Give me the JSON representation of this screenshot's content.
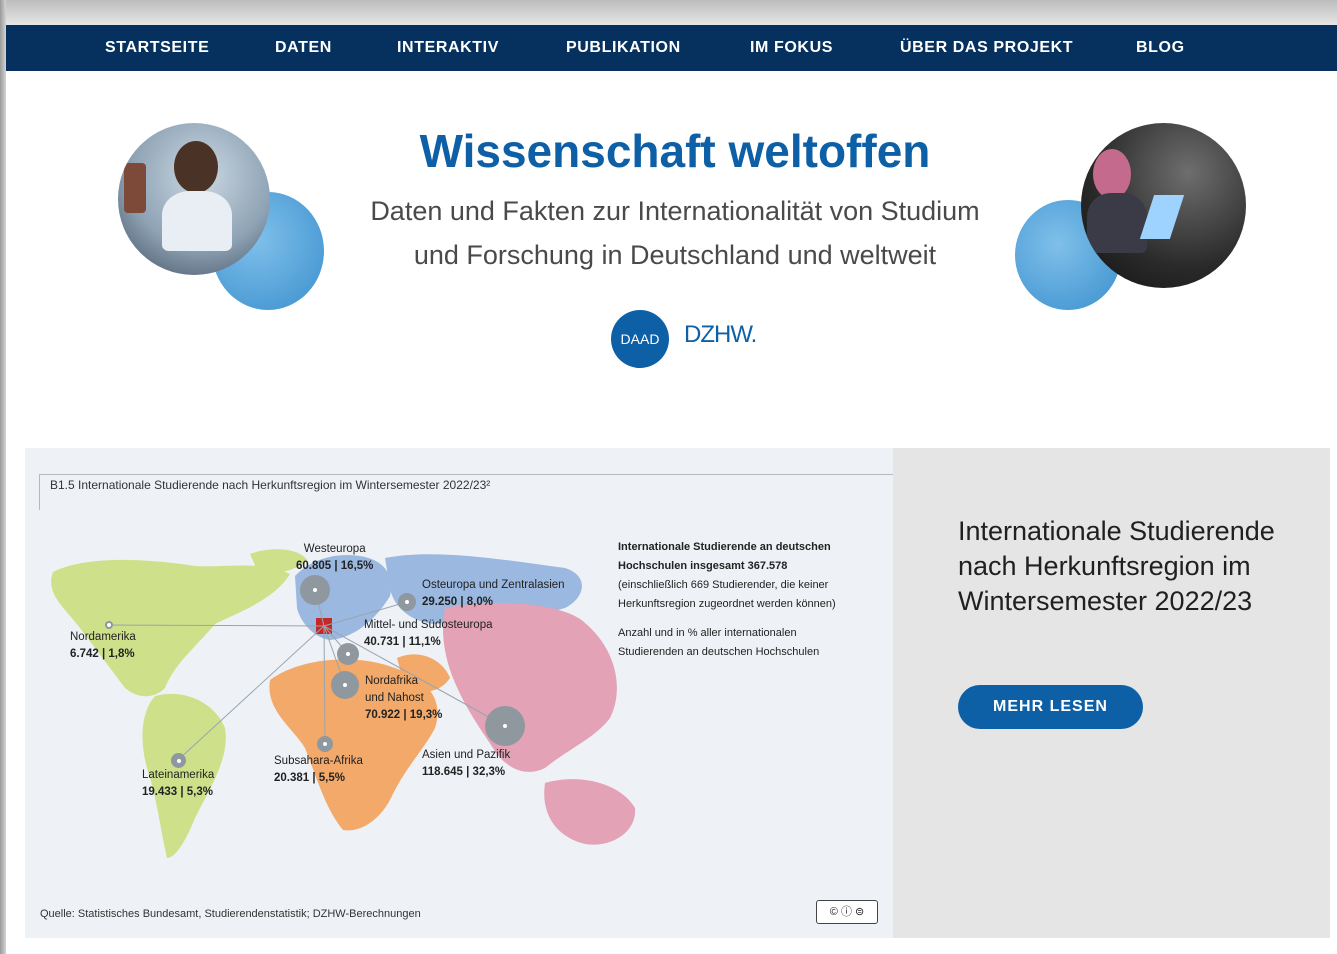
{
  "nav": {
    "items": [
      "STARTSEITE",
      "DATEN",
      "INTERAKTIV",
      "PUBLIKATION",
      "IM FOKUS",
      "ÜBER DAS PROJEKT",
      "BLOG"
    ]
  },
  "hero": {
    "title": "Wissenschaft weltoffen",
    "subtitle_line1": "Daten und Fakten zur Internationalität von Studium",
    "subtitle_line2": "und Forschung in Deutschland und weltweit",
    "logo_daad": "DAAD",
    "logo_dzhw": "DZHW."
  },
  "teaser": {
    "figure": {
      "title": "B1.5  Internationale Studierende nach Herkunftsregion im Wintersemester 2022/23²",
      "regions": [
        {
          "name": "Westeuropa",
          "value": "60.805 | 16,5%"
        },
        {
          "name": "Osteuropa und Zentralasien",
          "value": "29.250 | 8,0%"
        },
        {
          "name": "Mittel- und Südosteuropa",
          "value": "40.731 | 11,1%"
        },
        {
          "name": "Nordamerika",
          "value": "6.742 | 1,8%"
        },
        {
          "name_line1": "Nordafrika",
          "name_line2": "und Nahost",
          "value": "70.922 | 19,3%"
        },
        {
          "name": "Subsahara-Afrika",
          "value": "20.381 | 5,5%"
        },
        {
          "name": "Asien und Pazifik",
          "value": "118.645 | 32,3%"
        },
        {
          "name": "Lateinamerika",
          "value": "19.433 | 5,3%"
        }
      ],
      "info_line1": "Internationale Studierende an deutschen",
      "info_line2": "Hochschulen insgesamt 367.578",
      "info_line3": "(einschließlich 669 Studierender, die keiner",
      "info_line4": "Herkunftsregion zugeordnet werden können)",
      "info_line5": "Anzahl und in % aller internationalen",
      "info_line6": "Studierenden an deutschen Hochschulen",
      "source": "Quelle: Statistisches Bundesamt, Studierendenstatistik; DZHW-Berechnungen",
      "license": "© ⓘ ⊜"
    },
    "title": "Internationale Studierende nach Herkunftsregion im Wintersemester 2022/23",
    "button": "MEHR LESEN"
  },
  "colors": {
    "nav_bg": "#06315e",
    "brand_blue": "#0d5fa6",
    "map_europe": "#9ab8e0",
    "map_americas": "#cfe08a",
    "map_africa": "#f2a96a",
    "map_asia": "#e3a2b6"
  }
}
